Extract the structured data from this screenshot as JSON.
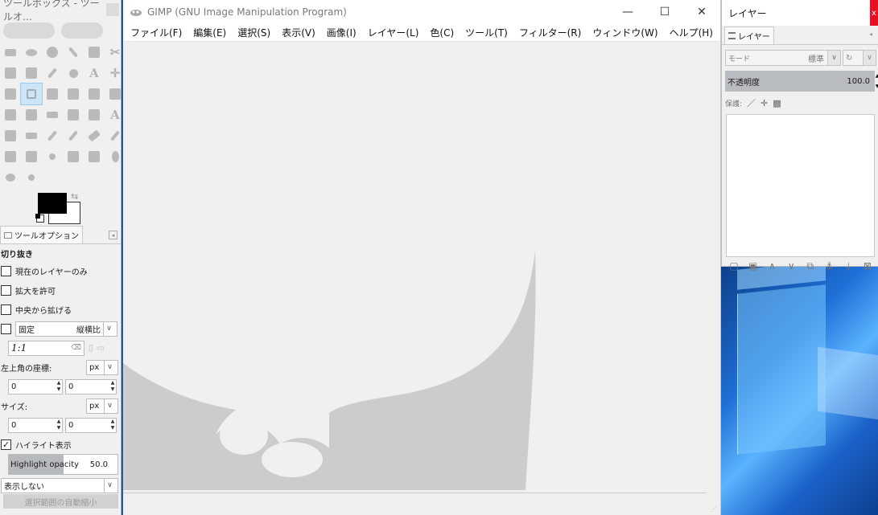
{
  "toolbox": {
    "title": "ツールボックス - ツールオ…",
    "tool_options_tab": "ツールオプション",
    "tool_name": "切り抜き",
    "current_layer_only": "現在のレイヤーのみ",
    "allow_growing": "拡大を許可",
    "expand_from_center": "中央から拡げる",
    "fixed_label": "固定",
    "fixed_option": "縦横比",
    "ratio_value": "1:1",
    "position_label": "左上角の座標:",
    "position_unit": "px",
    "pos_x": "0",
    "pos_y": "0",
    "size_label": "サイズ:",
    "size_unit": "px",
    "size_w": "0",
    "size_h": "0",
    "highlight_label": "ハイライト表示",
    "highlight_checked": true,
    "highlight_opacity_label": "Highlight opacity",
    "highlight_opacity_value": "50.0",
    "highlight_opacity_fraction": 0.5,
    "guides_option": "表示しない",
    "auto_shrink_button": "選択範囲の自動縮小"
  },
  "main": {
    "title": "GIMP (GNU Image Manipulation Program)",
    "menu": [
      "ファイル(F)",
      "編集(E)",
      "選択(S)",
      "表示(V)",
      "画像(I)",
      "レイヤー(L)",
      "色(C)",
      "ツール(T)",
      "フィルター(R)",
      "ウィンドウ(W)",
      "ヘルプ(H)"
    ],
    "minimize": "—",
    "maximize": "☐",
    "close": "✕"
  },
  "layers": {
    "title": "レイヤー",
    "close": "x",
    "tab": "レイヤー",
    "mode_label": "モード",
    "mode_value": "標準",
    "opacity_label": "不透明度",
    "opacity_value": "100.0",
    "lock_label": "保護:"
  },
  "colors": {
    "accent": "#1f74c9",
    "wilber_silhouette": "#cccccc",
    "close_red": "#e81123"
  }
}
